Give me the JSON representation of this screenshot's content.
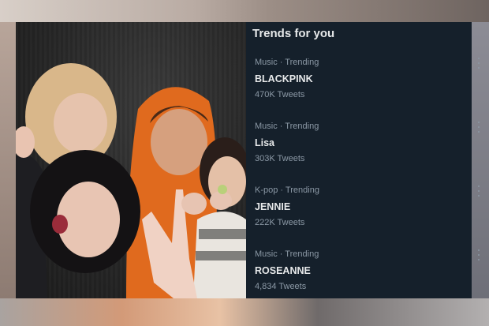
{
  "trends_panel": {
    "title": "Trends for you",
    "items": [
      {
        "meta": "Music · Trending",
        "name": "BLACKPINK",
        "count": "470K Tweets"
      },
      {
        "meta": "Music · Trending",
        "name": "Lisa",
        "count": "303K Tweets"
      },
      {
        "meta": "K-pop · Trending",
        "name": "JENNIE",
        "count": "222K Tweets"
      },
      {
        "meta": "Music · Trending",
        "name": "ROSEANNE",
        "count": "4,834 Tweets"
      }
    ],
    "more_icon": "more-vertical-icon",
    "background": "#15202b"
  }
}
